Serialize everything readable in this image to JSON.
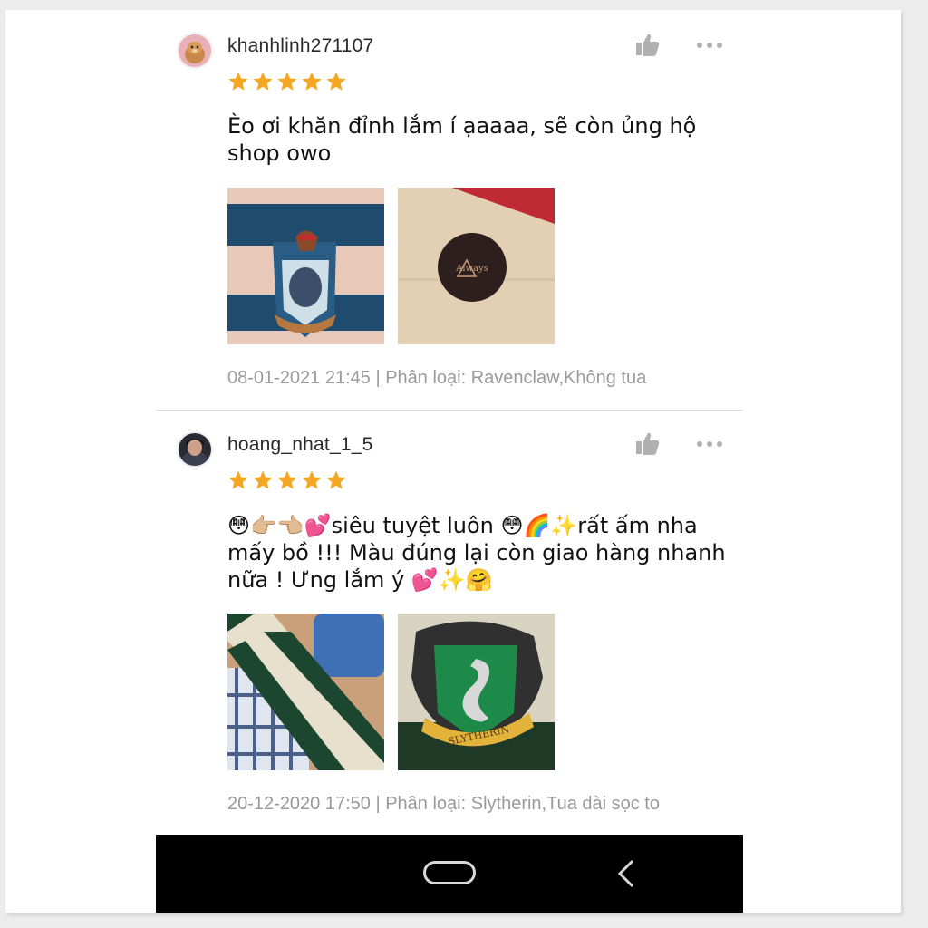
{
  "reviews": [
    {
      "username": "khanhlinh271107",
      "rating": 5,
      "comment": "Èo ơi khăn đỉnh lắm í ạaaaa, sẽ còn ủng hộ shop owo",
      "meta": "08-01-2021 21:45 | Phân loại: Ravenclaw,Không tua",
      "images": [
        "ravenclaw-scarf-crest",
        "always-sticker-package"
      ]
    },
    {
      "username": "hoang_nhat_1_5",
      "rating": 5,
      "comment": "😳👉🏼👈🏼💕siêu tuyệt luôn 😳🌈✨rất ấm nha mấy bồ !!! Màu đúng lại còn giao hàng nhanh nữa ! Ưng lắm ý 💕✨🤗",
      "meta": "20-12-2020 17:50 | Phân loại: Slytherin,Tua dài sọc to",
      "images": [
        "slytherin-scarf-stripes",
        "slytherin-crest"
      ]
    }
  ],
  "colors": {
    "star": "#F5A623",
    "meta_text": "#9a9a9a",
    "navbar": "#000000",
    "icon_grey": "#b0b0b0"
  },
  "icons": [
    "thumbs-up-icon",
    "more-dots-icon",
    "star-icon",
    "home-button-icon",
    "back-arrow-icon"
  ]
}
